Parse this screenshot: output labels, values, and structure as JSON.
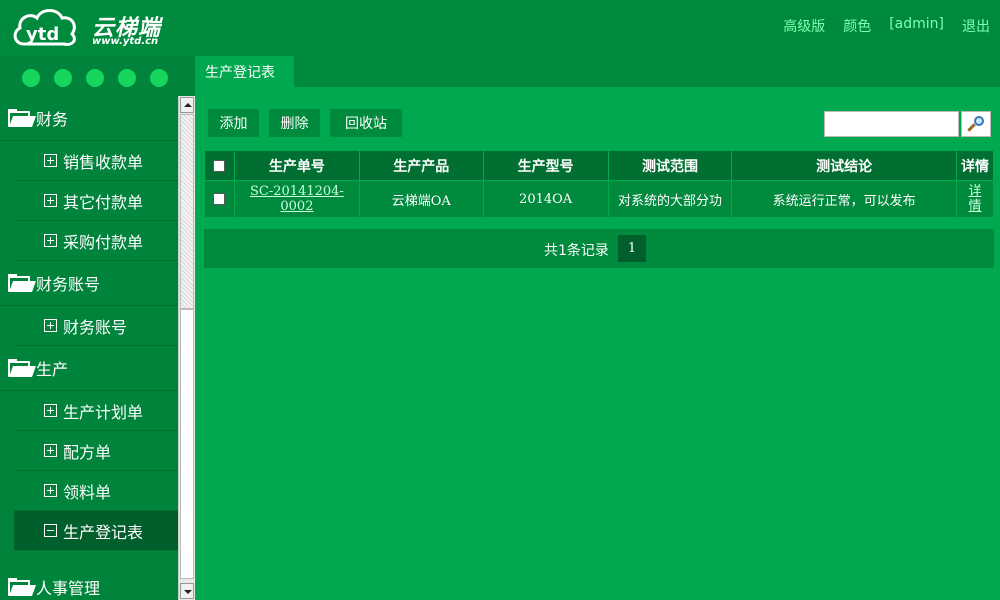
{
  "header": {
    "logo_text": "云梯端",
    "logo_url": "www.ytd.cn",
    "links": [
      "高级版",
      "颜色",
      "[admin]",
      "退出"
    ]
  },
  "sidebar": {
    "groups": [
      {
        "label": "财务",
        "items": [
          "销售收款单",
          "其它付款单",
          "采购付款单"
        ]
      },
      {
        "label": "财务账号",
        "items": [
          "财务账号"
        ]
      },
      {
        "label": "生产",
        "items": [
          "生产计划单",
          "配方单",
          "领料单",
          "生产登记表"
        ]
      },
      {
        "label": "人事管理",
        "items": []
      }
    ],
    "active_item": "生产登记表"
  },
  "main": {
    "tab_label": "生产登记表",
    "buttons": {
      "add": "添加",
      "delete": "删除",
      "recycle": "回收站"
    },
    "search": {
      "value": "",
      "placeholder": ""
    },
    "table": {
      "columns": [
        "生产单号",
        "生产产品",
        "生产型号",
        "测试范围",
        "测试结论",
        "详情"
      ],
      "rows": [
        {
          "order_no": "SC-20141204-0002",
          "product": "云梯端OA",
          "model": "2014OA",
          "scope": "对系统的大部分功",
          "conclusion": "系统运行正常，可以发布",
          "detail": "详情"
        }
      ]
    },
    "pager": {
      "summary": "共1条记录",
      "current_page": "1"
    }
  },
  "colors": {
    "background": "#00a84f",
    "header": "#008a3e",
    "active": "#005f2a",
    "accent": "#17d45e"
  }
}
